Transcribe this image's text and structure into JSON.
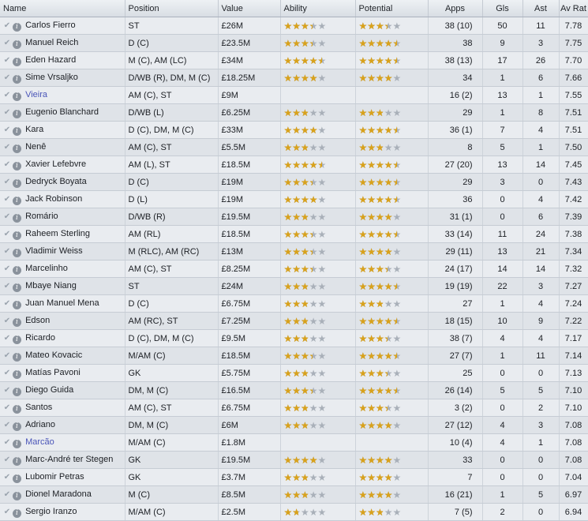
{
  "columns": [
    "Name",
    "Position",
    "Value",
    "Ability",
    "Potential",
    "Apps",
    "Gls",
    "Ast",
    "Av Rat"
  ],
  "players": [
    {
      "name": "Carlos Fierro",
      "position": "ST",
      "value": "£26M",
      "ability": 3,
      "potential": 3,
      "apps": "38 (10)",
      "gls": "50",
      "ast": "11",
      "avrat": "7.78",
      "link": false
    },
    {
      "name": "Manuel Reich",
      "position": "D (C)",
      "value": "£23.5M",
      "ability": 3,
      "potential": 4,
      "apps": "38",
      "gls": "9",
      "ast": "3",
      "avrat": "7.75",
      "link": false
    },
    {
      "name": "Eden Hazard",
      "position": "M (C), AM (LC)",
      "value": "£34M",
      "ability": 4,
      "potential": 4,
      "apps": "38 (13)",
      "gls": "17",
      "ast": "26",
      "avrat": "7.70",
      "link": false
    },
    {
      "name": "Sime Vrsaljko",
      "position": "D/WB (R), DM, M (C)",
      "value": "£18.25M",
      "ability": 3.5,
      "potential": 3.5,
      "apps": "34",
      "gls": "1",
      "ast": "6",
      "avrat": "7.66",
      "link": false
    },
    {
      "name": "Vieira",
      "position": "AM (C), ST",
      "value": "£9M",
      "ability": null,
      "potential": null,
      "apps": "16 (2)",
      "gls": "13",
      "ast": "1",
      "avrat": "7.55",
      "link": true
    },
    {
      "name": "Eugenio Blanchard",
      "position": "D/WB (L)",
      "value": "£6.25M",
      "ability": 2.5,
      "potential": 2.5,
      "apps": "29",
      "gls": "1",
      "ast": "8",
      "avrat": "7.51",
      "link": false
    },
    {
      "name": "Kara",
      "position": "D (C), DM, M (C)",
      "value": "£33M",
      "ability": 3.5,
      "potential": 4,
      "apps": "36 (1)",
      "gls": "7",
      "ast": "4",
      "avrat": "7.51",
      "link": false
    },
    {
      "name": "Nenê",
      "position": "AM (C), ST",
      "value": "£5.5M",
      "ability": 2.5,
      "potential": 2.5,
      "apps": "8",
      "gls": "5",
      "ast": "1",
      "avrat": "7.50",
      "link": false
    },
    {
      "name": "Xavier Lefebvre",
      "position": "AM (L), ST",
      "value": "£18.5M",
      "ability": 4,
      "potential": 4,
      "apps": "27 (20)",
      "gls": "13",
      "ast": "14",
      "avrat": "7.45",
      "link": false
    },
    {
      "name": "Dedryck Boyata",
      "position": "D (C)",
      "value": "£19M",
      "ability": 3,
      "potential": 4,
      "apps": "29",
      "gls": "3",
      "ast": "0",
      "avrat": "7.43",
      "link": false
    },
    {
      "name": "Jack Robinson",
      "position": "D (L)",
      "value": "£19M",
      "ability": 3.5,
      "potential": 4,
      "apps": "36",
      "gls": "0",
      "ast": "4",
      "avrat": "7.42",
      "link": false
    },
    {
      "name": "Romário",
      "position": "D/WB (R)",
      "value": "£19.5M",
      "ability": 2.5,
      "potential": 3.5,
      "apps": "31 (1)",
      "gls": "0",
      "ast": "6",
      "avrat": "7.39",
      "link": false
    },
    {
      "name": "Raheem Sterling",
      "position": "AM (RL)",
      "value": "£18.5M",
      "ability": 3,
      "potential": 4,
      "apps": "33 (14)",
      "gls": "11",
      "ast": "24",
      "avrat": "7.38",
      "link": false
    },
    {
      "name": "Vladimir Weiss",
      "position": "M (RLC), AM (RC)",
      "value": "£13M",
      "ability": 3,
      "potential": 3.5,
      "apps": "29 (11)",
      "gls": "13",
      "ast": "21",
      "avrat": "7.34",
      "link": false
    },
    {
      "name": "Marcelinho",
      "position": "AM (C), ST",
      "value": "£8.25M",
      "ability": 3,
      "potential": 3,
      "apps": "24 (17)",
      "gls": "14",
      "ast": "14",
      "avrat": "7.32",
      "link": false
    },
    {
      "name": "Mbaye Niang",
      "position": "ST",
      "value": "£24M",
      "ability": 2.5,
      "potential": 4,
      "apps": "19 (19)",
      "gls": "22",
      "ast": "3",
      "avrat": "7.27",
      "link": false
    },
    {
      "name": "Juan Manuel Mena",
      "position": "D (C)",
      "value": "£6.75M",
      "ability": 2.5,
      "potential": 2.5,
      "apps": "27",
      "gls": "1",
      "ast": "4",
      "avrat": "7.24",
      "link": false
    },
    {
      "name": "Edson",
      "position": "AM (RC), ST",
      "value": "£7.25M",
      "ability": 2.5,
      "potential": 4,
      "apps": "18 (15)",
      "gls": "10",
      "ast": "9",
      "avrat": "7.22",
      "link": false
    },
    {
      "name": "Ricardo",
      "position": "D (C), DM, M (C)",
      "value": "£9.5M",
      "ability": 2.5,
      "potential": 3,
      "apps": "38 (7)",
      "gls": "4",
      "ast": "4",
      "avrat": "7.17",
      "link": false
    },
    {
      "name": "Mateo Kovacic",
      "position": "M/AM (C)",
      "value": "£18.5M",
      "ability": 3,
      "potential": 4,
      "apps": "27 (7)",
      "gls": "1",
      "ast": "11",
      "avrat": "7.14",
      "link": false
    },
    {
      "name": "Matías Pavoni",
      "position": "GK",
      "value": "£5.75M",
      "ability": 2.5,
      "potential": 3,
      "apps": "25",
      "gls": "0",
      "ast": "0",
      "avrat": "7.13",
      "link": false
    },
    {
      "name": "Diego Guida",
      "position": "DM, M (C)",
      "value": "£16.5M",
      "ability": 3,
      "potential": 4,
      "apps": "26 (14)",
      "gls": "5",
      "ast": "5",
      "avrat": "7.10",
      "link": false
    },
    {
      "name": "Santos",
      "position": "AM (C), ST",
      "value": "£6.75M",
      "ability": 2.5,
      "potential": 3,
      "apps": "3 (2)",
      "gls": "0",
      "ast": "2",
      "avrat": "7.10",
      "link": false
    },
    {
      "name": "Adriano",
      "position": "DM, M (C)",
      "value": "£6M",
      "ability": 2.5,
      "potential": 3.5,
      "apps": "27 (12)",
      "gls": "4",
      "ast": "3",
      "avrat": "7.08",
      "link": false
    },
    {
      "name": "Marcão",
      "position": "M/AM (C)",
      "value": "£1.8M",
      "ability": null,
      "potential": null,
      "apps": "10 (4)",
      "gls": "4",
      "ast": "1",
      "avrat": "7.08",
      "link": true
    },
    {
      "name": "Marc-André ter Stegen",
      "position": "GK",
      "value": "£19.5M",
      "ability": 3.5,
      "potential": 3.5,
      "apps": "33",
      "gls": "0",
      "ast": "0",
      "avrat": "7.08",
      "link": false
    },
    {
      "name": "Lubomir Petras",
      "position": "GK",
      "value": "£3.7M",
      "ability": 2.5,
      "potential": 3.5,
      "apps": "7",
      "gls": "0",
      "ast": "0",
      "avrat": "7.04",
      "link": false
    },
    {
      "name": "Dionel Maradona",
      "position": "M (C)",
      "value": "£8.5M",
      "ability": 2.5,
      "potential": 3.5,
      "apps": "16 (21)",
      "gls": "1",
      "ast": "5",
      "avrat": "6.97",
      "link": false
    },
    {
      "name": "Sergio Iranzo",
      "position": "M/AM (C)",
      "value": "£2.5M",
      "ability": 1.5,
      "potential": 2.5,
      "apps": "7 (5)",
      "gls": "2",
      "ast": "0",
      "avrat": "6.94",
      "link": false
    }
  ]
}
